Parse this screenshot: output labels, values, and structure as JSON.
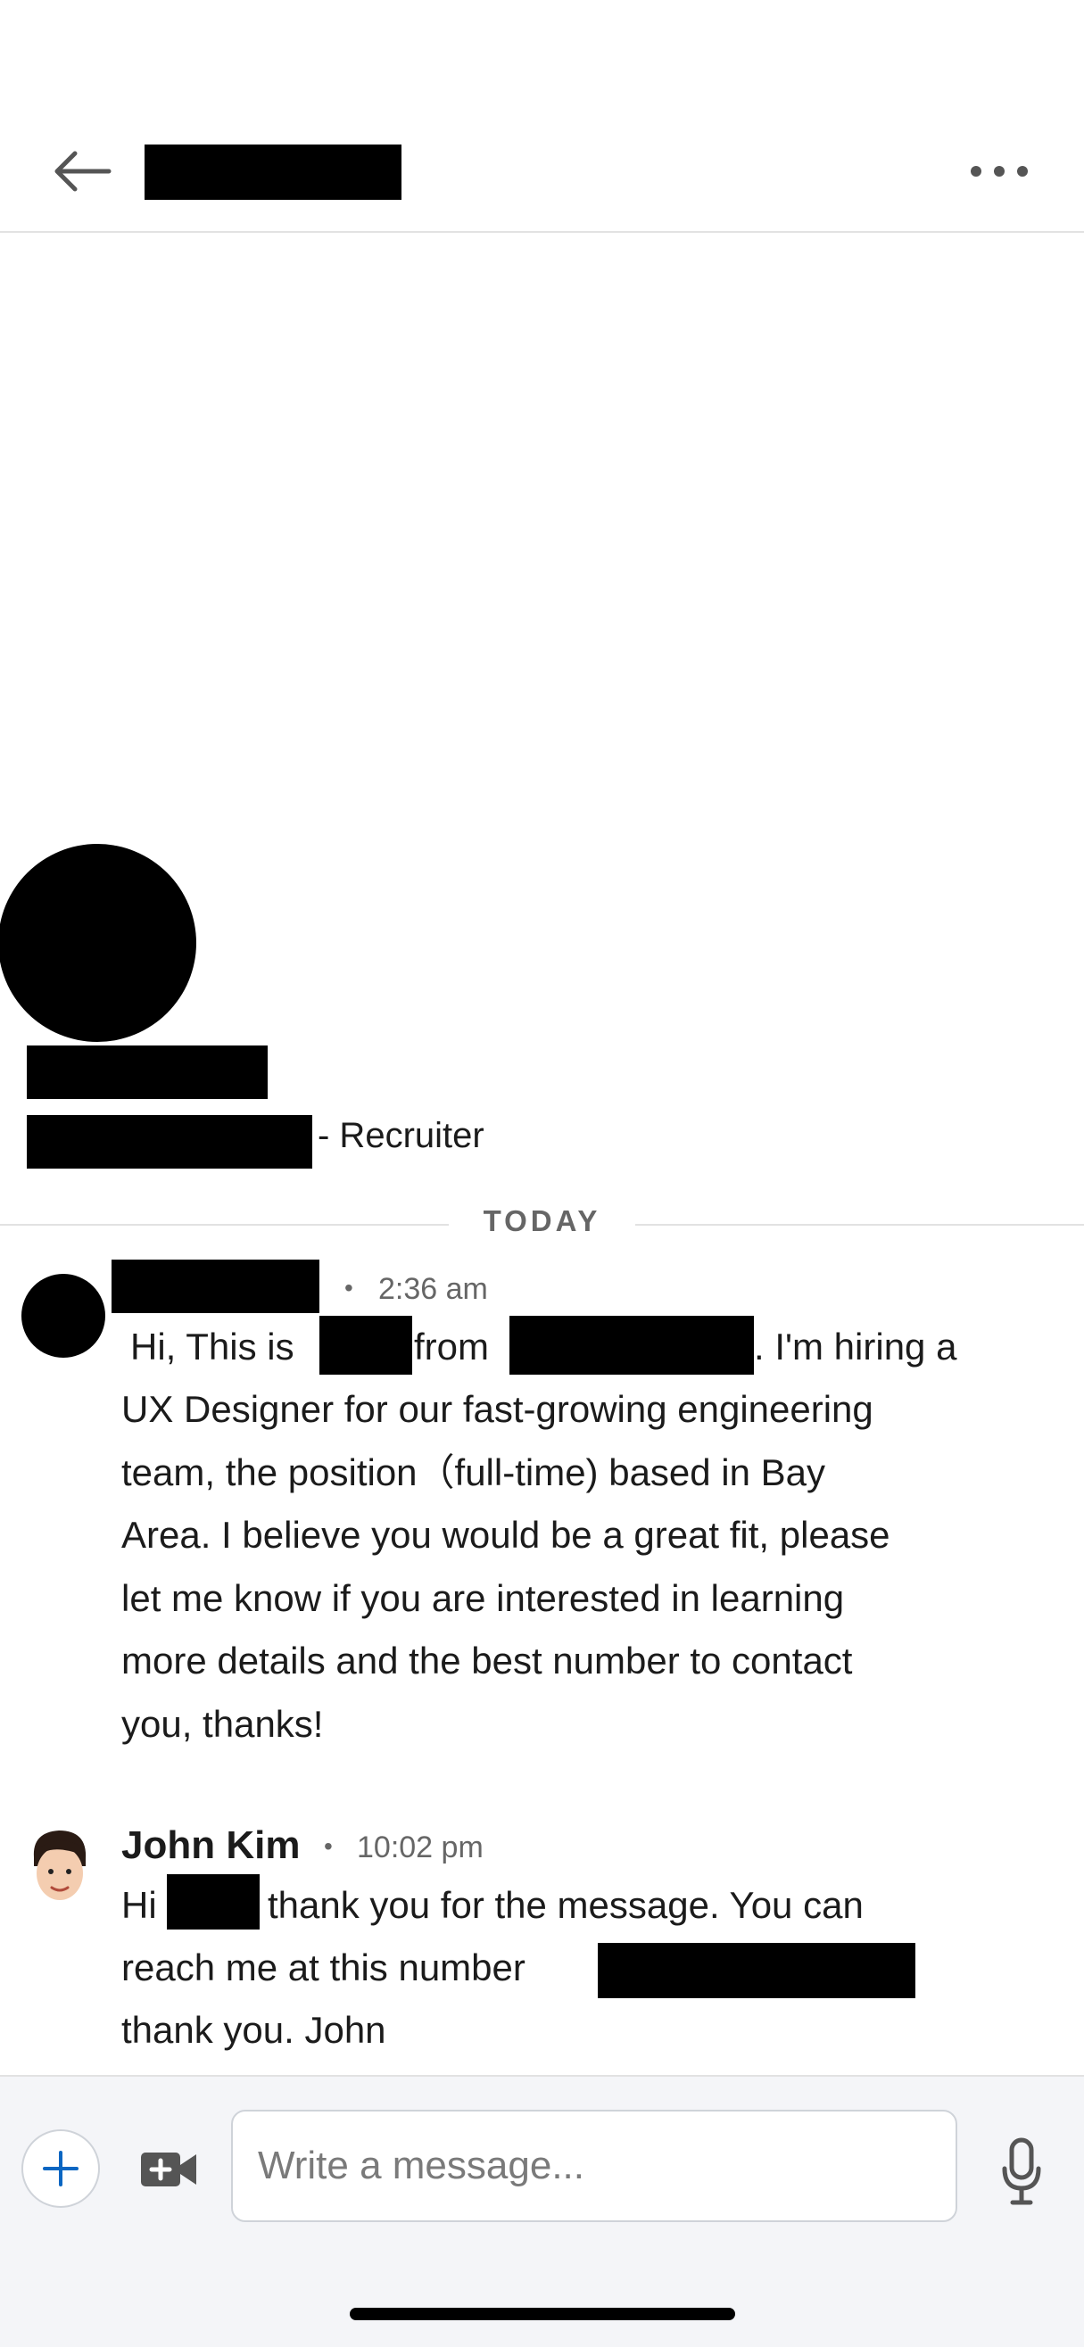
{
  "header": {
    "back_icon": "arrow-left-icon",
    "more_icon": "more-horizontal-icon"
  },
  "profile": {
    "role_suffix": "- Recruiter"
  },
  "divider": {
    "label": "TODAY"
  },
  "messages": [
    {
      "time": "2:36 am",
      "lines": [
        {
          "segments": [
            "Hi, This is",
            "from",
            ". I'm hiring a"
          ]
        },
        "UX Designer for our fast-growing engineering",
        "team, the position（full-time) based in Bay",
        "Area. I believe you would be a great fit, please",
        "let me know if you are interested in learning",
        "more details and the best number to contact",
        "you, thanks!"
      ]
    },
    {
      "sender": "John Kim",
      "time": "10:02 pm",
      "lines": [
        {
          "segments": [
            "Hi",
            "thank you for the message. You can"
          ]
        },
        {
          "segments": [
            "reach me at this number"
          ]
        },
        "thank you. John"
      ]
    }
  ],
  "composer": {
    "placeholder": "Write a message...",
    "add_icon": "plus-icon",
    "video_icon": "video-plus-icon",
    "mic_icon": "microphone-icon"
  },
  "colors": {
    "accent": "#0a66c2",
    "divider": "#e2e2e2",
    "composer_bg": "#f4f5f8"
  }
}
